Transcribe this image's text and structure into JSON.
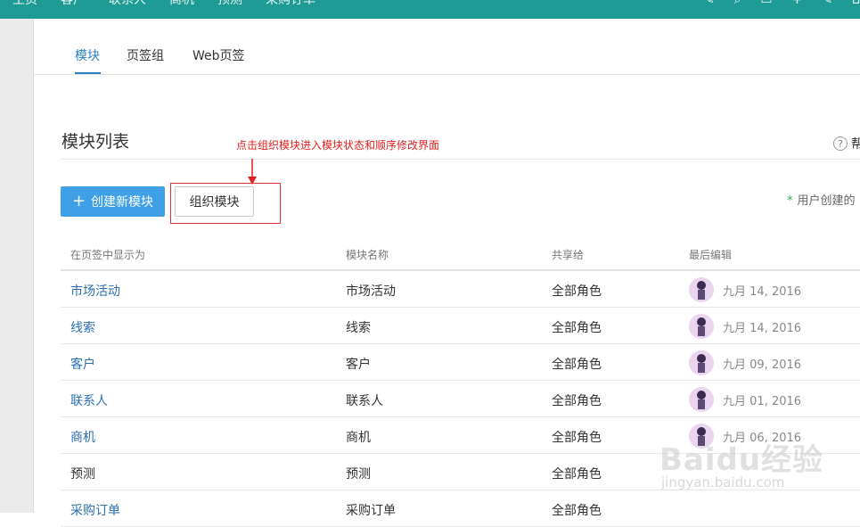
{
  "topnav": {
    "items": [
      "主页",
      "客户",
      "联系人",
      "商机",
      "预测",
      "采购订单"
    ],
    "tools": [
      "✎",
      "⌕",
      "▭",
      "+",
      "✎",
      "⌂"
    ]
  },
  "tabs": [
    {
      "label": "模块",
      "active": true
    },
    {
      "label": "页签组",
      "active": false
    },
    {
      "label": "Web页签",
      "active": false
    }
  ],
  "page_title": "模块列表",
  "help": {
    "icon": "?",
    "label": "帮"
  },
  "annotation": "点击组织模块进入模块状态和顺序修改界面",
  "buttons": {
    "create": "创建新模块",
    "organize": "组织模块"
  },
  "legend": {
    "star": "*",
    "label": "用户创建的"
  },
  "table": {
    "columns": [
      "在页签中显示为",
      "模块名称",
      "共享给",
      "最后编辑"
    ],
    "rows": [
      {
        "display": "市场活动",
        "name": "市场活动",
        "shared": "全部角色",
        "edited": "九月 14, 2016",
        "link": true
      },
      {
        "display": "线索",
        "name": "线索",
        "shared": "全部角色",
        "edited": "九月 14, 2016",
        "link": true
      },
      {
        "display": "客户",
        "name": "客户",
        "shared": "全部角色",
        "edited": "九月 09, 2016",
        "link": true
      },
      {
        "display": "联系人",
        "name": "联系人",
        "shared": "全部角色",
        "edited": "九月 01, 2016",
        "link": true
      },
      {
        "display": "商机",
        "name": "商机",
        "shared": "全部角色",
        "edited": "九月 06, 2016",
        "link": true
      },
      {
        "display": "预测",
        "name": "预测",
        "shared": "全部角色",
        "edited": "",
        "link": false
      },
      {
        "display": "采购订单",
        "name": "采购订单",
        "shared": "全部角色",
        "edited": "",
        "link": true
      }
    ]
  },
  "watermark": {
    "brand": "Baidu经验",
    "url": "jingyan.baidu.com"
  },
  "colors": {
    "topbar": "#1e9b95",
    "accent": "#2a7fc1",
    "create_button": "#3fa0e8",
    "annotation": "#e02020"
  }
}
